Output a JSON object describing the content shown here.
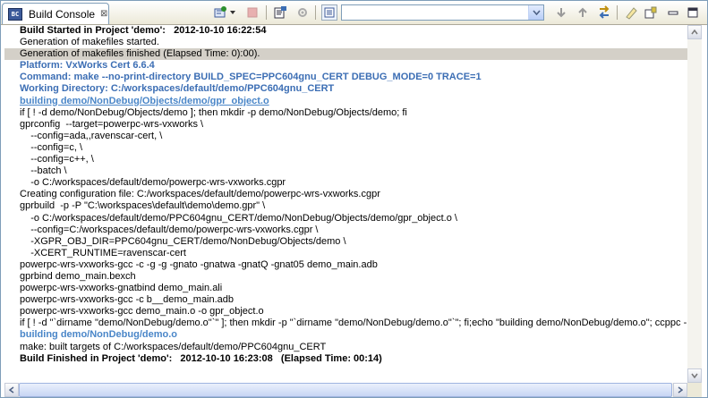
{
  "tab": {
    "title": "Build Console",
    "icon": "build-console-icon",
    "close": "⊠"
  },
  "toolbar": {
    "selector_value": "",
    "icons": [
      "new-console-icon",
      "stop-icon",
      "copy-build-log-icon",
      "settings-icon",
      "display-console-icon",
      "down-icon",
      "up-icon",
      "swap-icon",
      "clear-console-icon",
      "scroll-lock-icon",
      "minimize-icon",
      "maximize-icon"
    ]
  },
  "colors": {
    "blue_text": "#3c6eb4",
    "link_text": "#4a86c8",
    "highlight": "#d4d0c8"
  },
  "console": {
    "lines": [
      "Build Started in Project 'demo':   2012-10-10 16:22:54",
      "Generation of makefiles started.",
      "Generation of makefiles finished (Elapsed Time: 0):00).",
      "Platform: VxWorks Cert 6.6.4",
      "Command: make --no-print-directory BUILD_SPEC=PPC604gnu_CERT DEBUG_MODE=0 TRACE=1",
      "Working Directory: C:/workspaces/default/demo/PPC604gnu_CERT",
      "building demo/NonDebug/Objects/demo/gpr_object.o",
      "if [ ! -d demo/NonDebug/Objects/demo ]; then mkdir -p demo/NonDebug/Objects/demo; fi",
      "gprconfig  --target=powerpc-wrs-vxworks \\",
      "    --config=ada,,ravenscar-cert, \\",
      "    --config=c, \\",
      "    --config=c++, \\",
      "    --batch \\",
      "    -o C:/workspaces/default/demo/powerpc-wrs-vxworks.cgpr",
      "Creating configuration file: C:/workspaces/default/demo/powerpc-wrs-vxworks.cgpr",
      "gprbuild  -p -P \"C:\\workspaces\\default\\demo\\demo.gpr\" \\",
      "    -o C:/workspaces/default/demo/PPC604gnu_CERT/demo/NonDebug/Objects/demo/gpr_object.o \\",
      "    --config=C:/workspaces/default/demo/powerpc-wrs-vxworks.cgpr \\",
      "    -XGPR_OBJ_DIR=PPC604gnu_CERT/demo/NonDebug/Objects/demo \\",
      "    -XCERT_RUNTIME=ravenscar-cert",
      "powerpc-wrs-vxworks-gcc -c -g -g -gnato -gnatwa -gnatQ -gnat05 demo_main.adb",
      "gprbind demo_main.bexch",
      "powerpc-wrs-vxworks-gnatbind demo_main.ali",
      "powerpc-wrs-vxworks-gcc -c b__demo_main.adb",
      "powerpc-wrs-vxworks-gcc demo_main.o -o gpr_object.o",
      "if [ ! -d \"`dirname \"demo/NonDebug/demo.o\"`\" ]; then mkdir -p \"`dirname \"demo/NonDebug/demo.o\"`\"; fi;echo \"building demo/NonDebug/demo.o\"; ccppc -",
      "building demo/NonDebug/demo.o",
      "make: built targets of C:/workspaces/default/demo/PPC604gnu_CERT",
      "Build Finished in Project 'demo':   2012-10-10 16:23:08   (Elapsed Time: 00:14)"
    ],
    "styles": [
      "bold",
      "",
      "hl",
      "blue",
      "blue",
      "blue",
      "blue-link",
      "",
      "",
      "",
      "",
      "",
      "",
      "",
      "",
      "",
      "",
      "",
      "",
      "",
      "",
      "",
      "",
      "",
      "",
      "",
      "blue-plain",
      "",
      "bold"
    ]
  }
}
